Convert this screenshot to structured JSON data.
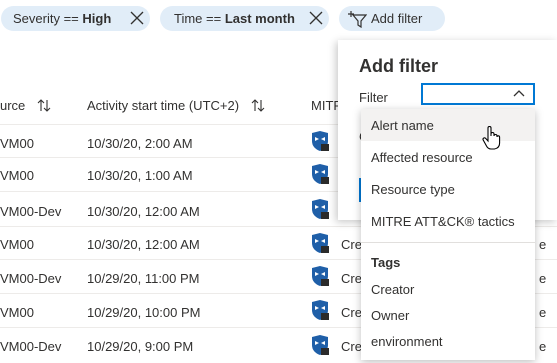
{
  "filters": {
    "severity": {
      "key": "Severity",
      "op": "==",
      "value": "High"
    },
    "time": {
      "key": "Time",
      "op": "==",
      "value": "Last month"
    },
    "add_filter_label": "Add filter"
  },
  "table": {
    "headers": {
      "resource": "urce",
      "activity_start": "Activity start time (UTC+2)",
      "mitre": "MITR"
    },
    "rows": [
      {
        "resource": "VM00",
        "time": "10/30/20, 2:00 AM",
        "creator": ""
      },
      {
        "resource": "VM00",
        "time": "10/30/20, 1:00 AM",
        "creator": ""
      },
      {
        "resource": "VM00-Dev",
        "time": "10/30/20, 12:00 AM",
        "creator": ""
      },
      {
        "resource": "VM00",
        "time": "10/30/20, 12:00 AM",
        "creator": "Cre"
      },
      {
        "resource": "VM00-Dev",
        "time": "10/29/20, 11:00 PM",
        "creator": "Cre"
      },
      {
        "resource": "VM00",
        "time": "10/29/20, 10:00 PM",
        "creator": "Cre"
      },
      {
        "resource": "VM00-Dev",
        "time": "10/29/20, 9:00 PM",
        "creator": "Cre"
      }
    ]
  },
  "panel": {
    "title": "Add filter",
    "filter_label": "Filter",
    "frag_c": "C"
  },
  "dropdown": {
    "items": [
      "Alert name",
      "Affected resource",
      "Resource type",
      "MITRE ATT&CK® tactics"
    ],
    "group_header": "Tags",
    "tag_items": [
      "Creator",
      "Owner",
      "environment"
    ]
  },
  "colors": {
    "accent": "#0078d4",
    "pill_bg": "#e1edf8",
    "hover": "#f3f2f1"
  }
}
